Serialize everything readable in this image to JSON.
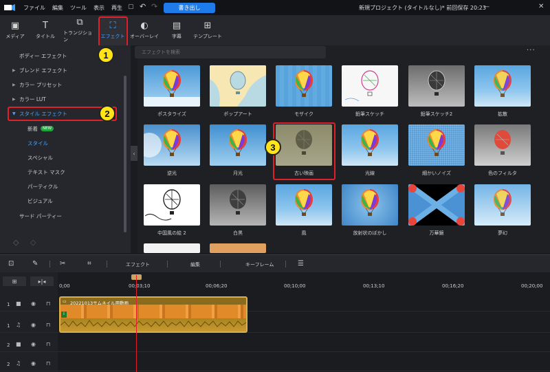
{
  "menu": [
    "ファイル",
    "編集",
    "ツール",
    "表示",
    "再生"
  ],
  "export_label": "書き出し",
  "project_title": "新規プロジェクト (タイトルなし)* 前回保存 20:23",
  "tabs": [
    {
      "label": "メディア",
      "icon": "media-icon"
    },
    {
      "label": "タイトル",
      "icon": "title-icon"
    },
    {
      "label": "トランジション",
      "icon": "transition-icon"
    },
    {
      "label": "エフェクト",
      "icon": "effect-icon"
    },
    {
      "label": "オーバーレイ",
      "icon": "overlay-icon"
    },
    {
      "label": "字幕",
      "icon": "subtitle-icon"
    },
    {
      "label": "テンプレート",
      "icon": "template-icon"
    }
  ],
  "sidebar": {
    "items": [
      {
        "label": "ボディー エフェクト"
      },
      {
        "label": "ブレンド エフェクト"
      },
      {
        "label": "カラー プリセット"
      },
      {
        "label": "カラー LUT"
      },
      {
        "label": "スタイル エフェクト"
      },
      {
        "label": "新着"
      },
      {
        "label": "スタイル"
      },
      {
        "label": "スペシャル"
      },
      {
        "label": "テキスト マスク"
      },
      {
        "label": "パーティクル"
      },
      {
        "label": "ビジュアル"
      },
      {
        "label": "サード パーティー"
      }
    ],
    "new_badge": "NEW"
  },
  "search": {
    "placeholder": "エフェクトを検索"
  },
  "effects": [
    {
      "label": "ポスタライズ"
    },
    {
      "label": "ポップアート"
    },
    {
      "label": "モザイク"
    },
    {
      "label": "鉛筆スケッチ"
    },
    {
      "label": "鉛筆スケッチ2"
    },
    {
      "label": "拡散"
    },
    {
      "label": "逆光"
    },
    {
      "label": "月光"
    },
    {
      "label": "古い映画"
    },
    {
      "label": "光線"
    },
    {
      "label": "細かいノイズ"
    },
    {
      "label": "色のフィルタ"
    },
    {
      "label": "中国風の絵 2"
    },
    {
      "label": "白黒"
    },
    {
      "label": "風"
    },
    {
      "label": "放射状のぼかし"
    },
    {
      "label": "万華鏡"
    },
    {
      "label": "夢幻"
    }
  ],
  "annotations": [
    "1",
    "2",
    "3"
  ],
  "timeline": {
    "toolbar": [
      "エフェクト",
      "編集",
      "キーフレーム"
    ],
    "times": [
      "0;00",
      "00;03;10",
      "00;06;20",
      "00;10;00",
      "00;13;10",
      "00;16;20",
      "00;20;00"
    ],
    "tracks": [
      {
        "num": "1",
        "type": "video"
      },
      {
        "num": "1",
        "type": "audio"
      },
      {
        "num": "2",
        "type": "video"
      },
      {
        "num": "2",
        "type": "audio"
      }
    ],
    "clip_title": "20221013サムネイル用動画"
  }
}
